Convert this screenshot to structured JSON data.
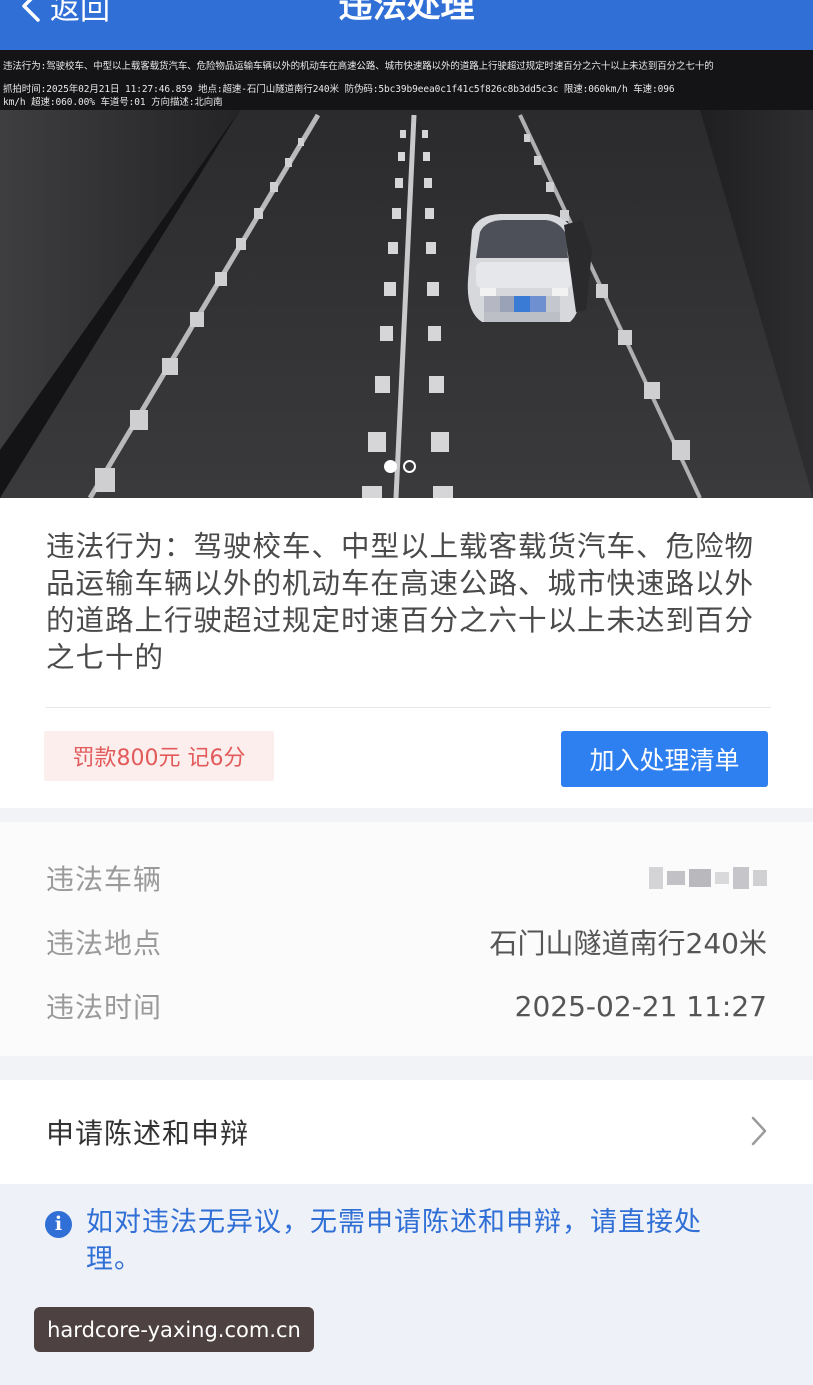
{
  "header": {
    "back_label": "返回",
    "title": "违法处理"
  },
  "photo": {
    "overlay_line1": "违法行为:驾驶校车、中型以上载客载货汽车、危险物品运输车辆以外的机动车在高速公路、城市快速路以外的道路上行驶超过规定时速百分之六十以上未达到百分之七十的",
    "overlay_line2": "抓拍时间:2025年02月21日 11:27:46.859 地点:超速-石门山隧道南行240米 防伪码:5bc39b9eea0c1f41c5f826c8b3dd5c3c 限速:060km/h 车速:096",
    "overlay_line3": "km/h 超速:060.00% 车道号:01 方向描述:北向南",
    "carousel_count": 2,
    "carousel_active": 0
  },
  "violation": {
    "description": "违法行为：驾驶校车、中型以上载客载货汽车、危险物品运输车辆以外的机动车在高速公路、城市快速路以外的道路上行驶超过规定时速百分之六十以上未达到百分之七十的",
    "fine_label": "罚款800元 记6分",
    "add_button": "加入处理清单"
  },
  "details": {
    "vehicle_label": "违法车辆",
    "location_label": "违法地点",
    "location_value": "石门山隧道南行240米",
    "time_label": "违法时间",
    "time_value": "2025-02-21 11:27"
  },
  "appeal": {
    "label": "申请陈述和申辩"
  },
  "notice": {
    "text": "如对违法无异议，无需申请陈述和申辩，请直接处理。"
  },
  "watermark": "hardcore-yaxing.com.cn",
  "colors": {
    "header_bg": "#2f6fd6",
    "primary_button": "#2e7ff0",
    "fine_text": "#e25a5a",
    "fine_bg": "#fdeeee",
    "notice_text": "#2f6fd6"
  }
}
